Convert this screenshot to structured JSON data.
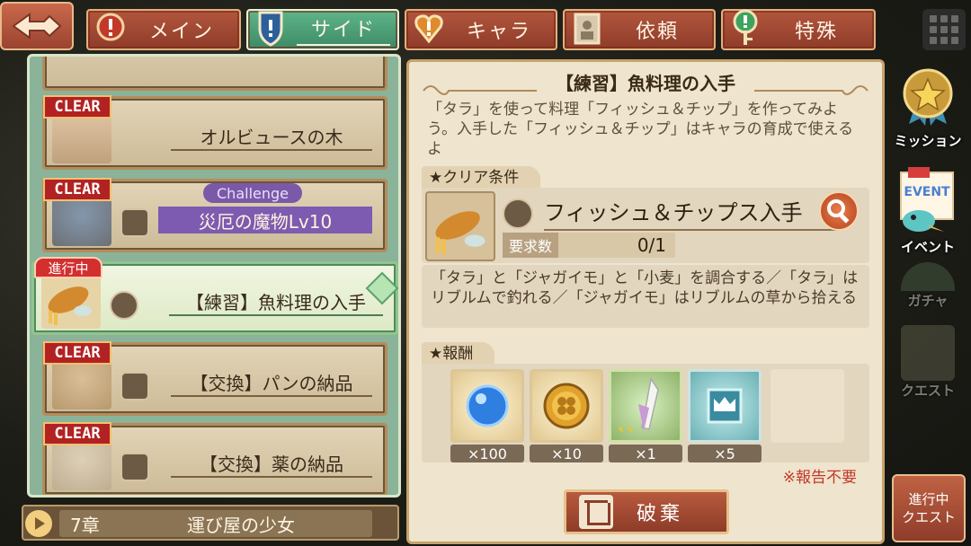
{
  "tabs": [
    {
      "label": "メイン",
      "active": false
    },
    {
      "label": "サイド",
      "active": true
    },
    {
      "label": "キャラ",
      "active": false
    },
    {
      "label": "依頼",
      "active": false
    },
    {
      "label": "特殊",
      "active": false
    }
  ],
  "quest_list": [
    {
      "tag": "CLEAR",
      "title": "オルビュースの木"
    },
    {
      "tag": "CLEAR",
      "badge": "Challenge",
      "title": "災厄の魔物Lv10"
    },
    {
      "tag": "進行中",
      "title": "【練習】魚料理の入手"
    },
    {
      "tag": "CLEAR",
      "title": "【交換】パンの納品"
    },
    {
      "tag": "CLEAR",
      "title": "【交換】薬の納品"
    }
  ],
  "chapter": {
    "number": "7章",
    "name": "運び屋の少女"
  },
  "detail": {
    "title": "【練習】魚料理の入手",
    "description": "「タラ」を使って料理「フィッシュ＆チップ」を作ってみよう。入手した「フィッシュ＆チップ」はキャラの育成で使えるよ",
    "clear_condition_header": "クリア条件",
    "condition_text": "フィッシュ＆チップス入手",
    "required_label": "要求数",
    "required_value": "0/1",
    "hint": "「タラ」と「ジャガイモ」と「小麦」を調合する／「タラ」はリブルムで釣れる／「ジャガイモ」はリブルムの草から拾える",
    "reward_header": "報酬",
    "rewards": [
      {
        "item": "blue-orb",
        "qty": "×100"
      },
      {
        "item": "gold-clover-coin",
        "qty": "×10"
      },
      {
        "item": "crystal-feather",
        "qty": "×1",
        "stars": 2
      },
      {
        "item": "crown-ticket",
        "qty": "×5"
      }
    ],
    "no_report_note": "※報告不要",
    "discard_label": "破棄"
  },
  "side_menu": [
    {
      "label": "ミッション"
    },
    {
      "label": "EVENT"
    },
    {
      "label": "イベント"
    },
    {
      "label": "ガチャ"
    },
    {
      "label": "クエスト"
    }
  ],
  "active_quest_button": {
    "line1": "進行中",
    "line2": "クエスト"
  },
  "colors": {
    "active_tab": "#4fa37a",
    "tab": "#a14a34",
    "clear_tag": "#b22222",
    "note_red": "#c0392b"
  }
}
